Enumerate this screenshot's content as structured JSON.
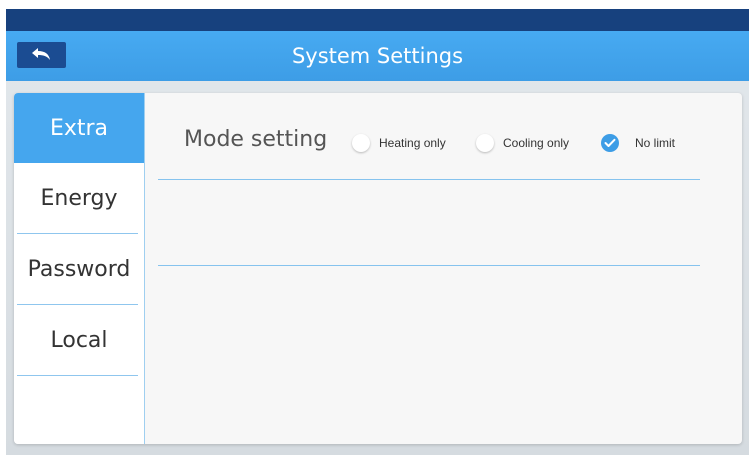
{
  "header": {
    "title": "System Settings",
    "back_icon": "back-arrow-icon"
  },
  "sidebar": {
    "items": [
      {
        "label": "Extra",
        "active": true
      },
      {
        "label": "Energy",
        "active": false
      },
      {
        "label": "Password",
        "active": false
      },
      {
        "label": "Local",
        "active": false
      }
    ]
  },
  "mode_setting": {
    "label": "Mode setting",
    "options": [
      {
        "label": "Heating only",
        "selected": false
      },
      {
        "label": "Cooling only",
        "selected": false
      },
      {
        "label": "No limit",
        "selected": true
      }
    ]
  },
  "colors": {
    "status_bar": "#17417e",
    "title_bar": "#45a6ee",
    "accent": "#3d9de6"
  }
}
